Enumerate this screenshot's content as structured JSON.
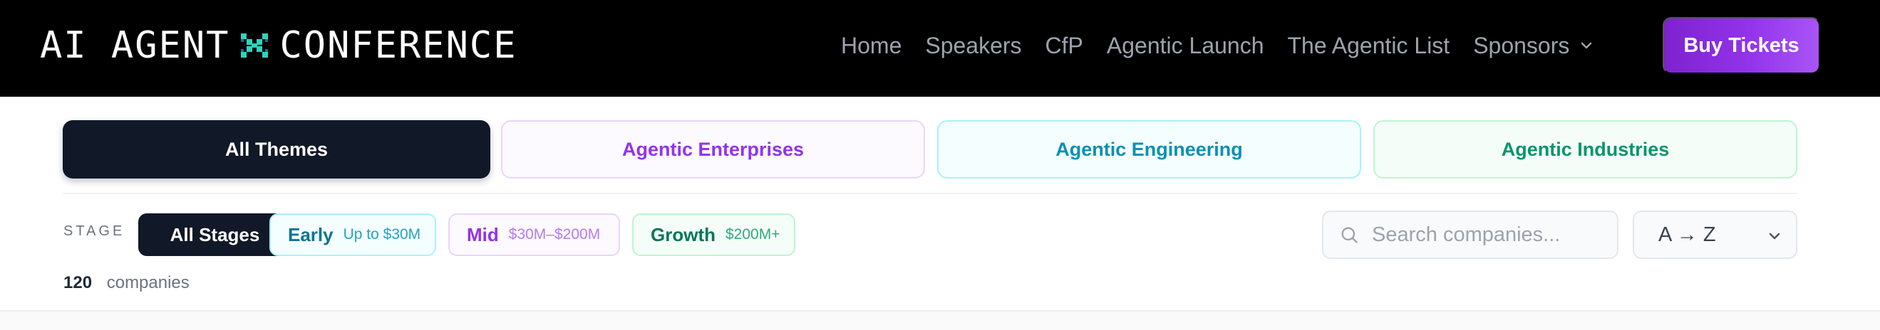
{
  "logo": {
    "left_text": "AI AGENT",
    "right_text": "CONFERENCE",
    "mark_icon": "x-cross-icon",
    "mark_color": "#2dd4bf"
  },
  "nav": {
    "links": [
      "Home",
      "Speakers",
      "CfP",
      "Agentic Launch",
      "The Agentic List"
    ],
    "dropdown_label": "Sponsors",
    "dropdown_icon": "chevron-down-icon",
    "cta_label": "Buy Tickets",
    "cta_color": "#9333ea"
  },
  "themes": {
    "all": "All Themes",
    "enterprises": "Agentic Enterprises",
    "engineering": "Agentic Engineering",
    "industries": "Agentic Industries",
    "colors": {
      "enterprises": "#9333ea",
      "engineering": "#0891b2",
      "industries": "#059669"
    }
  },
  "stage": {
    "label": "STAGE",
    "all": "All Stages",
    "early": {
      "label": "Early",
      "range": "Up to $30M"
    },
    "mid": {
      "label": "Mid",
      "range": "$30M–$200M"
    },
    "growth": {
      "label": "Growth",
      "range": "$200M+"
    }
  },
  "search": {
    "placeholder": "Search companies...",
    "value": "",
    "icon": "search-icon"
  },
  "sort": {
    "selected": "A → Z",
    "icon": "chevron-down-icon"
  },
  "results": {
    "count": "120",
    "label": "companies"
  }
}
